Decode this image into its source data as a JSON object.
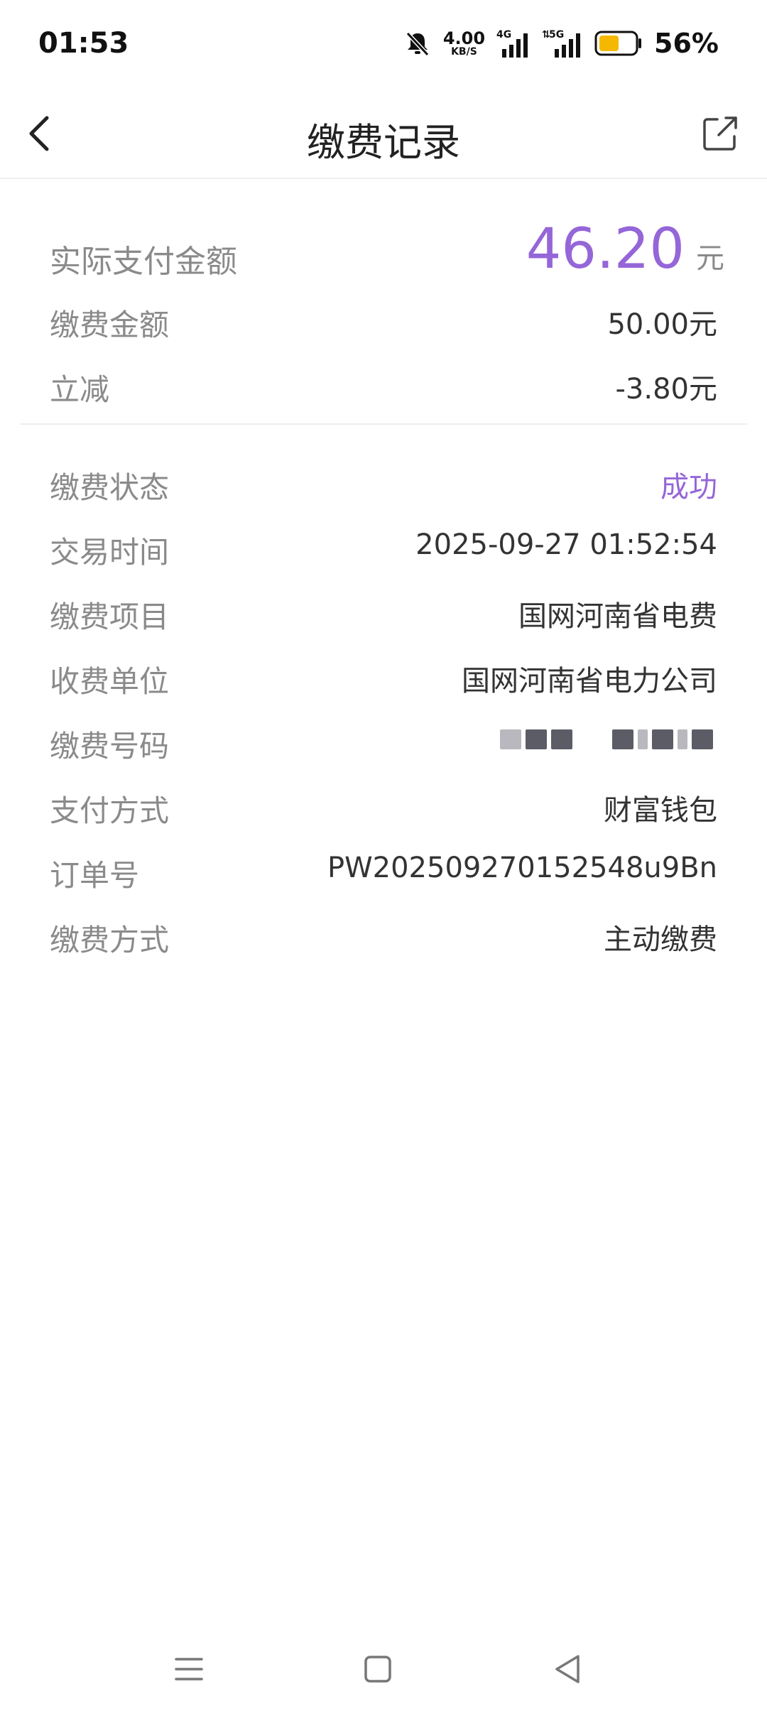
{
  "status_bar": {
    "time": "01:53",
    "net_speed_value": "4.00",
    "net_speed_unit": "KB/S",
    "signal1_label": "4G",
    "signal2_label": "5G",
    "battery_percent": "56%",
    "battery_level": 0.56,
    "battery_color": "#f5b800"
  },
  "header": {
    "title": "缴费记录",
    "back_icon": "chevron-left-icon",
    "share_icon": "share-icon"
  },
  "summary": {
    "actual_paid_label": "实际支付金额",
    "actual_paid_value": "46.20",
    "actual_paid_unit": "元",
    "payment_amount_label": "缴费金额",
    "payment_amount_value": "50.00元",
    "discount_label": "立减",
    "discount_value": "-3.80元"
  },
  "details": {
    "status_label": "缴费状态",
    "status_value": "成功",
    "time_label": "交易时间",
    "time_value": "2025-09-27 01:52:54",
    "item_label": "缴费项目",
    "item_value": "国网河南省电费",
    "unit_label": "收费单位",
    "unit_value": "国网河南省电力公司",
    "number_label": "缴费号码",
    "method_label": "支付方式",
    "method_value": "财富钱包",
    "order_label": "订单号",
    "order_value": "PW202509270152548u9Bn",
    "pay_type_label": "缴费方式",
    "pay_type_value": "主动缴费"
  },
  "colors": {
    "accent": "#9566d8",
    "label_gray": "#8a8a8a",
    "value_dark": "#333333"
  }
}
